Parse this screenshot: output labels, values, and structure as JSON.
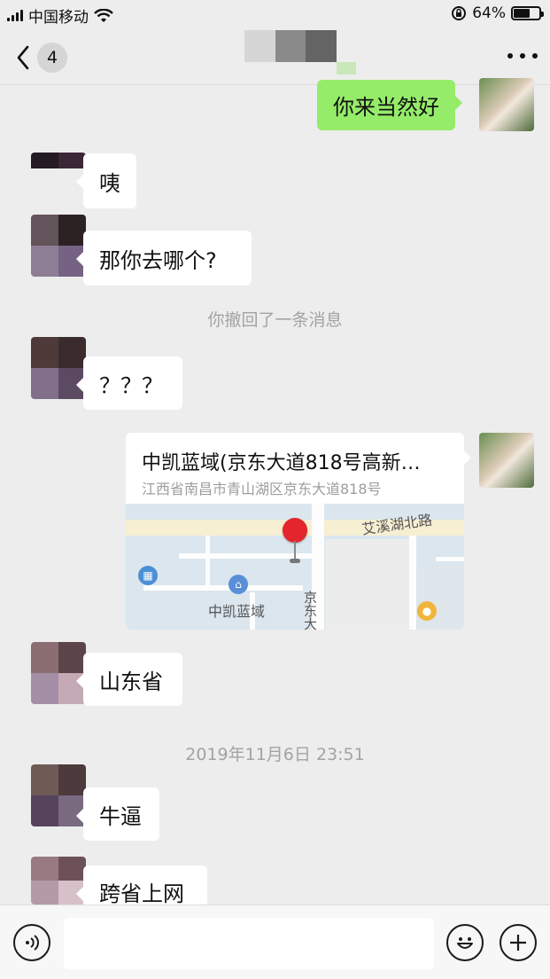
{
  "status_bar": {
    "carrier": "中国移动",
    "battery": "64%",
    "battery_level": 0.64
  },
  "nav": {
    "unread_count": "4"
  },
  "messages": {
    "m1": "你来当然好",
    "m2": "咦",
    "m3": "那你去哪个?",
    "recall_notice": "你撤回了一条消息",
    "m4": "？？？",
    "location": {
      "name": "中凯蓝域(京东大道818号高新…",
      "address": "江西省南昌市青山湖区京东大道818号",
      "map_labels": {
        "road_name": "艾溪湖北路",
        "place_name": "中凯蓝域",
        "vertical_road": "京东大"
      }
    },
    "m5": "山东省",
    "timestamp": "2019年11月6日 23:51",
    "m6": "牛逼",
    "m7": "跨省上网"
  },
  "colors": {
    "background": "#ededed",
    "sent_bubble": "#95ec69",
    "received_bubble": "#ffffff",
    "system_text": "#a3a3a3"
  },
  "icons": {
    "back": "chevron-left-icon",
    "more": "more-icon",
    "voice": "voice-icon",
    "emoji": "emoji-icon",
    "plus": "plus-icon",
    "location_pin": "map-pin-icon"
  }
}
